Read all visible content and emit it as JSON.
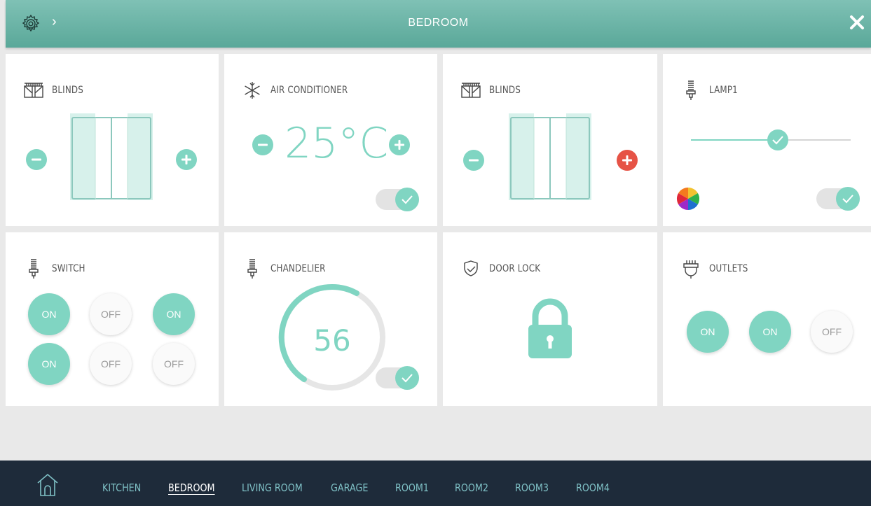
{
  "header": {
    "title": "BEDROOM",
    "chevron": "›"
  },
  "cards": {
    "blinds1": {
      "title": "BLINDS"
    },
    "aircon": {
      "title": "AIR CONDITIONER",
      "temperature": "25°C",
      "toggle_on": true
    },
    "blinds2": {
      "title": "BLINDS"
    },
    "lamp1": {
      "title": "LAMP1",
      "slider_value_fraction": 0.56,
      "toggle_on": true
    },
    "switch": {
      "title": "SWITCH",
      "buttons": [
        "ON",
        "OFF",
        "ON",
        "ON",
        "OFF",
        "OFF"
      ]
    },
    "chandelier": {
      "title": "CHANDELIER",
      "value": "56",
      "toggle_on": true
    },
    "doorlock": {
      "title": "DOOR LOCK"
    },
    "outlets": {
      "title": "OUTLETS",
      "buttons": [
        "ON",
        "ON",
        "OFF"
      ]
    }
  },
  "footer": {
    "nav": [
      "KITCHEN",
      "BEDROOM",
      "LIVING ROOM",
      "GARAGE",
      "ROOM1",
      "ROOM2",
      "ROOM3",
      "ROOM4"
    ],
    "active": "BEDROOM"
  },
  "colors": {
    "accent": "#80d5c2",
    "header": "#6ab3a6",
    "footer": "#1e2b3a",
    "alert": "#e65346"
  }
}
